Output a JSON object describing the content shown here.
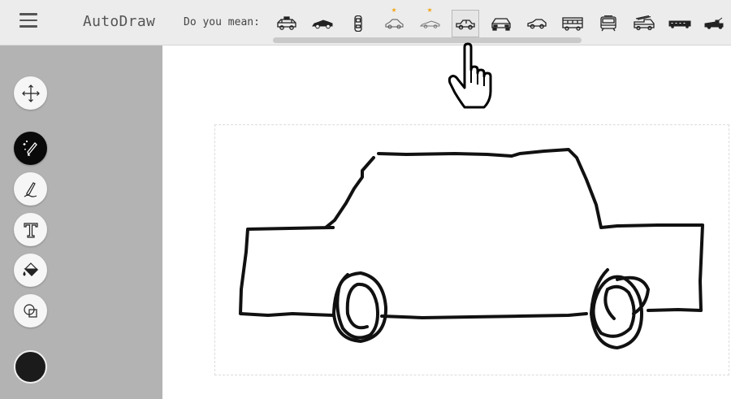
{
  "header": {
    "app_title": "AutoDraw",
    "do_you_mean_label": "Do you mean:",
    "menu_icon": "hamburger-menu-icon"
  },
  "suggestions": [
    {
      "name": "police-car",
      "starred": false,
      "selected": false
    },
    {
      "name": "sports-car",
      "starred": false,
      "selected": false
    },
    {
      "name": "car-top-view",
      "starred": false,
      "selected": false
    },
    {
      "name": "car-outline",
      "starred": true,
      "selected": false
    },
    {
      "name": "sports-car-outline",
      "starred": true,
      "selected": false
    },
    {
      "name": "sedan",
      "starred": false,
      "selected": true
    },
    {
      "name": "car-front",
      "starred": false,
      "selected": false
    },
    {
      "name": "hatchback",
      "starred": false,
      "selected": false
    },
    {
      "name": "bus",
      "starred": false,
      "selected": false
    },
    {
      "name": "tram",
      "starred": false,
      "selected": false
    },
    {
      "name": "fire-truck",
      "starred": false,
      "selected": false
    },
    {
      "name": "train",
      "starred": false,
      "selected": false
    },
    {
      "name": "tow-truck",
      "starred": false,
      "selected": false
    }
  ],
  "tools": [
    {
      "name": "select",
      "icon": "move-arrows-icon",
      "active": false
    },
    {
      "name": "autodraw",
      "icon": "magic-pencil-icon",
      "active": true
    },
    {
      "name": "draw",
      "icon": "pen-icon",
      "active": false
    },
    {
      "name": "type",
      "icon": "text-icon",
      "active": false
    },
    {
      "name": "fill",
      "icon": "paint-bucket-icon",
      "active": false
    },
    {
      "name": "shape",
      "icon": "shapes-icon",
      "active": false
    }
  ],
  "colors": {
    "topbar": "#ececec",
    "sidebar": "#b3b3b3",
    "active_tool": "#0a0a0a",
    "current_color": "#1b1b1b",
    "star": "#f2a81d",
    "stroke": "#111111"
  }
}
